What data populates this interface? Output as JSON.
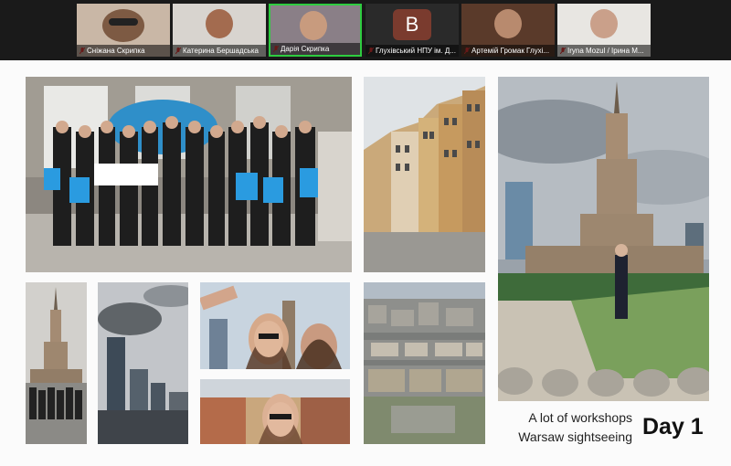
{
  "participants": [
    {
      "name": "Сніжана Скрипка"
    },
    {
      "name": "Катерина Бершадська"
    },
    {
      "name": "Дарія Скрипка"
    },
    {
      "name": "Глухівський НПУ ім. Д...",
      "initial": "B"
    },
    {
      "name": "Артемій Громак Глухі..."
    },
    {
      "name": "Iryna Mozul / Ірина М..."
    }
  ],
  "slide": {
    "caption_line1": "A lot of workshops",
    "caption_line2": "Warsaw sightseeing",
    "day_label": "Day 1"
  },
  "colors": {
    "active_speaker": "#2ecc40",
    "muted_mic": "#e53935",
    "slide_background": "#fbfbfb"
  },
  "icons": [
    "muted-mic-icon"
  ]
}
